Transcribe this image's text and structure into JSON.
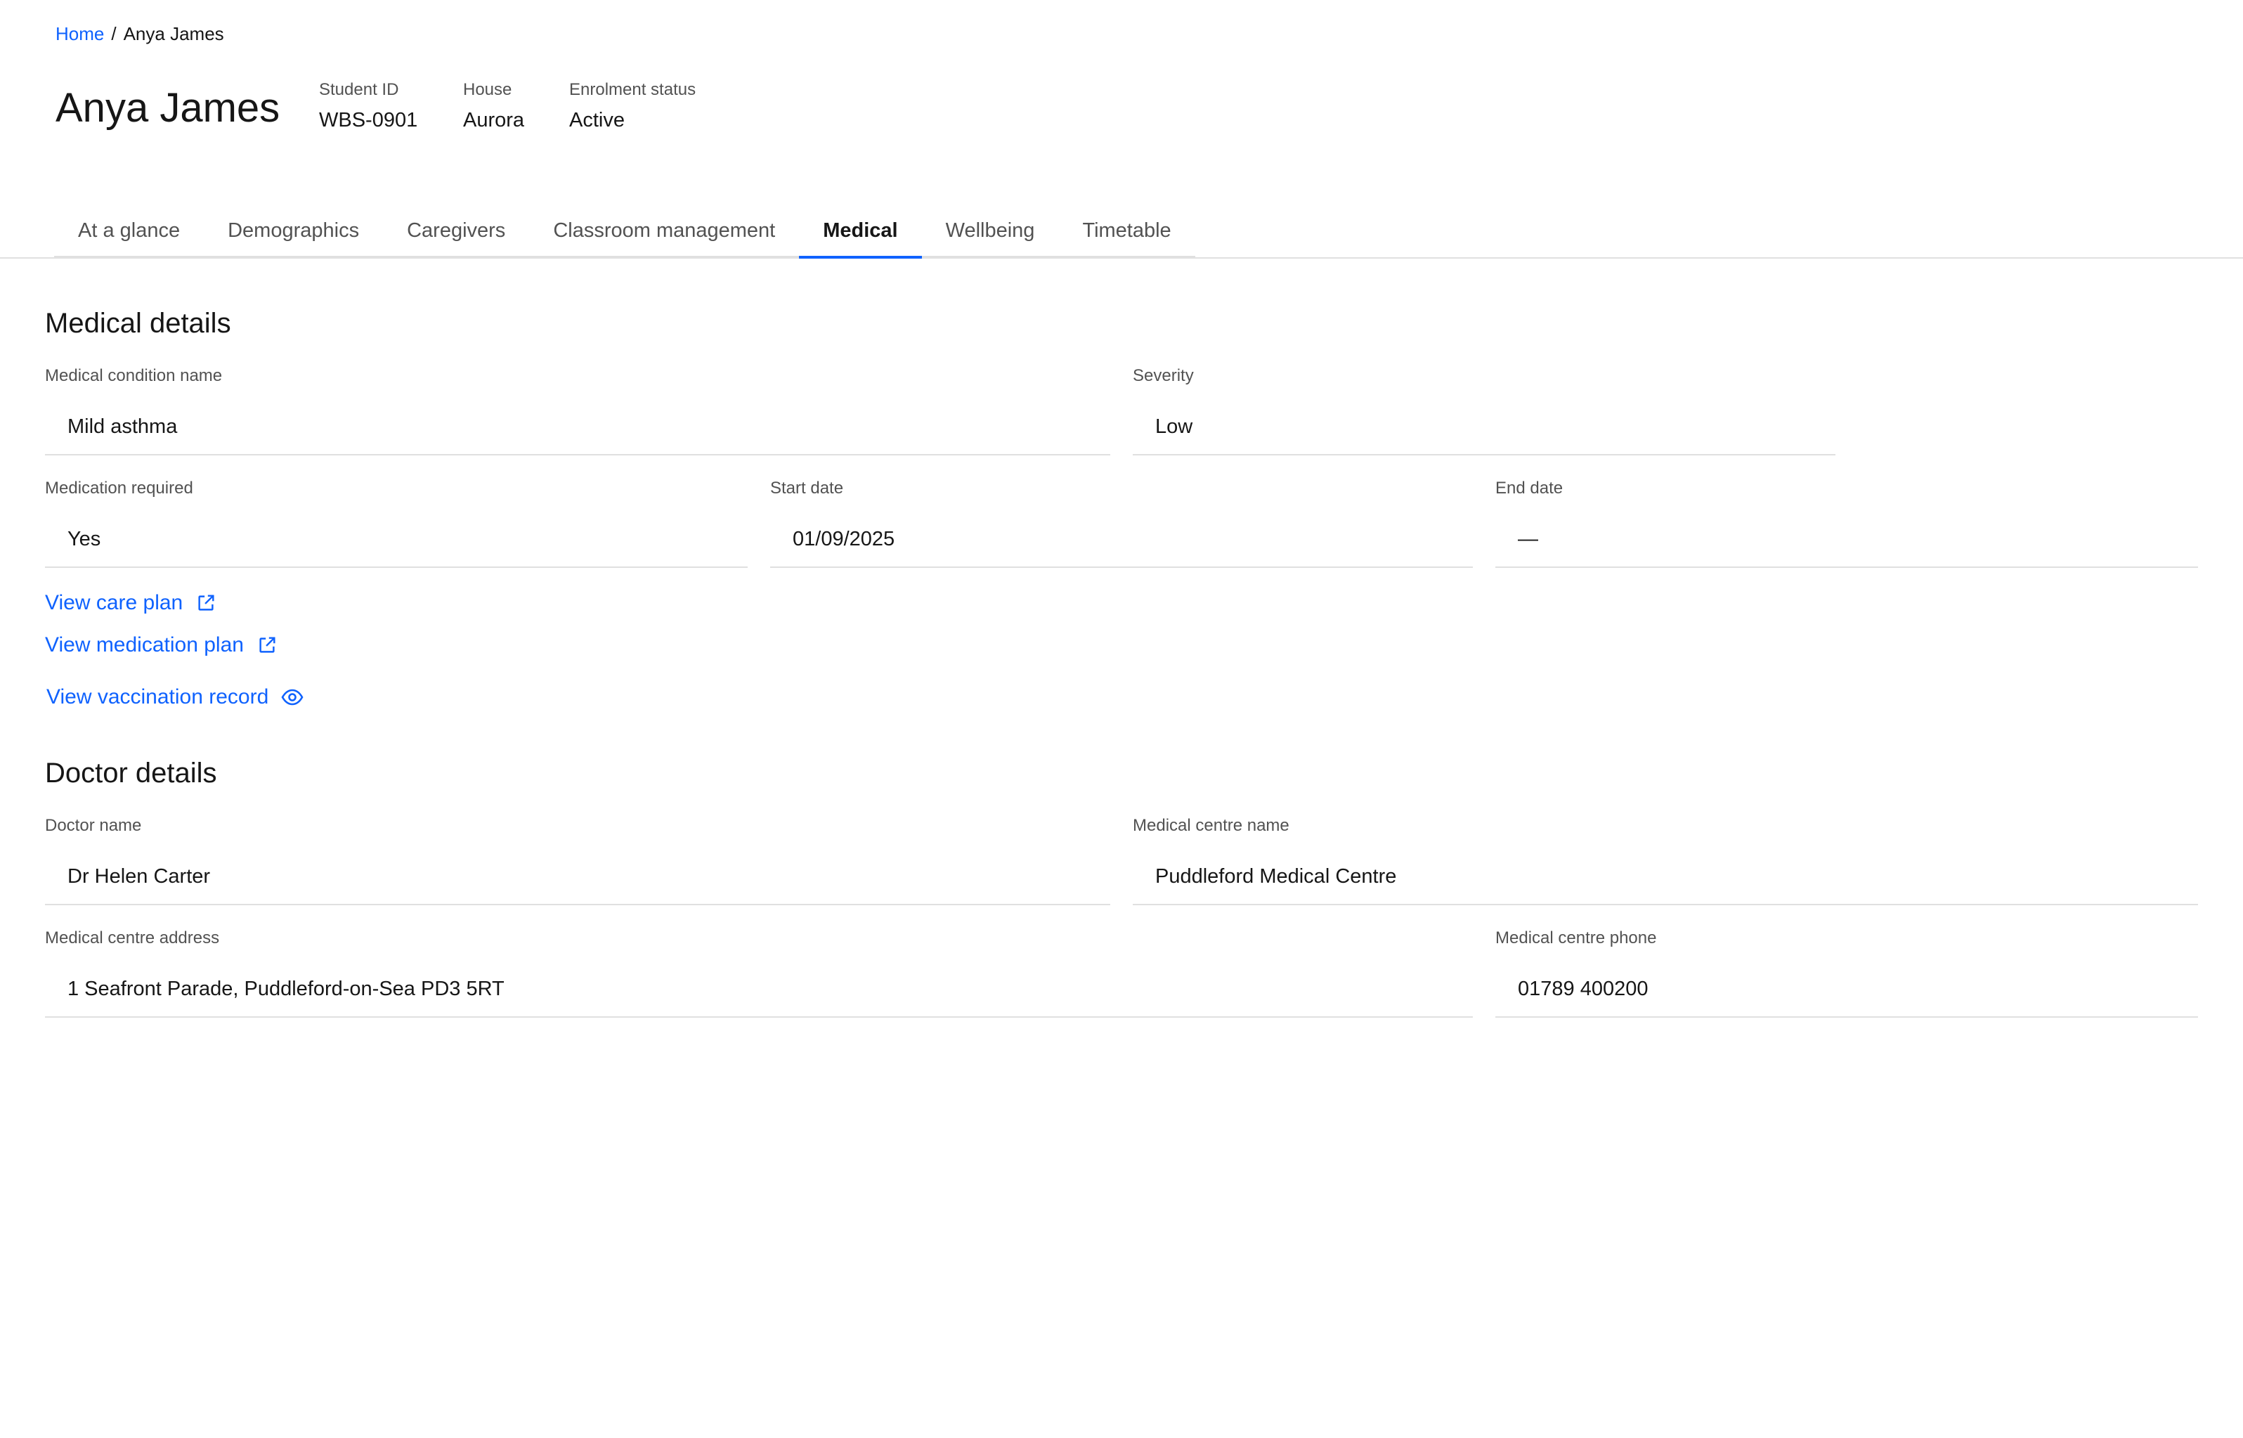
{
  "breadcrumb": {
    "home": "Home",
    "separator": "/",
    "current": "Anya James"
  },
  "header": {
    "title": "Anya James",
    "meta": [
      {
        "label": "Student ID",
        "value": "WBS-0901"
      },
      {
        "label": "House",
        "value": "Aurora"
      },
      {
        "label": "Enrolment status",
        "value": "Active"
      }
    ]
  },
  "tabs": [
    {
      "label": "At a glance",
      "active": false
    },
    {
      "label": "Demographics",
      "active": false
    },
    {
      "label": "Caregivers",
      "active": false
    },
    {
      "label": "Classroom management",
      "active": false
    },
    {
      "label": "Medical",
      "active": true
    },
    {
      "label": "Wellbeing",
      "active": false
    },
    {
      "label": "Timetable",
      "active": false
    }
  ],
  "medical": {
    "title": "Medical details",
    "condition": {
      "label": "Medical condition name",
      "value": "Mild asthma"
    },
    "severity": {
      "label": "Severity",
      "value": "Low"
    },
    "medication": {
      "label": "Medication required",
      "value": "Yes"
    },
    "start": {
      "label": "Start date",
      "value": "01/09/2025"
    },
    "end": {
      "label": "End date",
      "value": "—"
    },
    "links": {
      "care_plan": {
        "label": "View care plan",
        "icon": "external-link-icon"
      },
      "medication_plan": {
        "label": "View medication plan",
        "icon": "external-link-icon"
      },
      "vaccination": {
        "label": "View vaccination record",
        "icon": "eye-icon"
      }
    }
  },
  "doctor": {
    "title": "Doctor details",
    "name": {
      "label": "Doctor name",
      "value": "Dr Helen Carter"
    },
    "centre": {
      "label": "Medical centre name",
      "value": "Puddleford Medical Centre"
    },
    "address": {
      "label": "Medical centre address",
      "value": "1 Seafront Parade, Puddleford-on-Sea PD3 5RT"
    },
    "phone": {
      "label": "Medical centre phone",
      "value": "01789 400200"
    }
  },
  "colors": {
    "link": "#0f62fe",
    "text": "#161616",
    "muted": "#525252",
    "border": "#e0e0e0"
  }
}
